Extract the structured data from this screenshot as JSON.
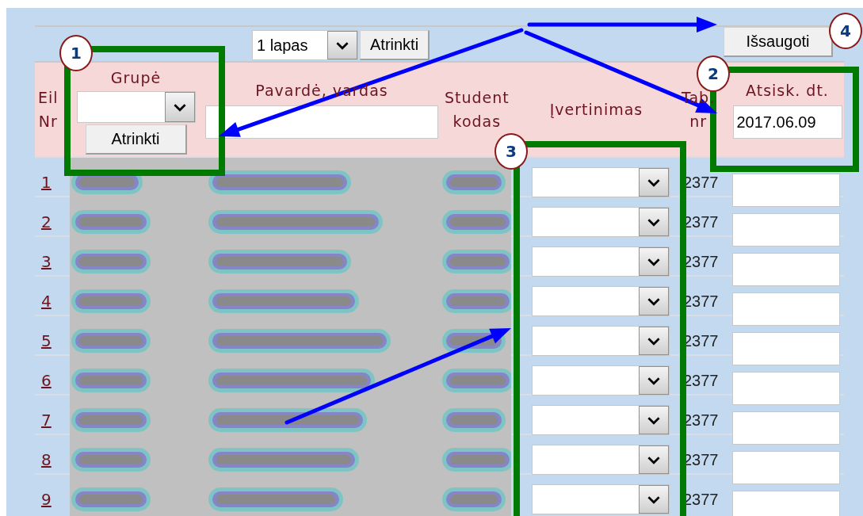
{
  "toolbar": {
    "page_select": {
      "value": "1 lapas"
    },
    "filter_button": "Atrinkti",
    "save_button": "Išsaugoti"
  },
  "header": {
    "row_number": [
      "Eil",
      "Nr"
    ],
    "group": {
      "label": "Grupė",
      "filter_button": "Atrinkti"
    },
    "name": {
      "label": "Pavardė, vardas"
    },
    "student_code": [
      "Student",
      "kodas"
    ],
    "grade": "Įvertinimas",
    "tab_number": [
      "Tab.",
      "nr"
    ],
    "settlement_date": {
      "label": "Atsisk. dt.",
      "value": "2017.06.09"
    }
  },
  "rows": [
    {
      "number": "1",
      "tab_number": "2377"
    },
    {
      "number": "2",
      "tab_number": "2377"
    },
    {
      "number": "3",
      "tab_number": "2377"
    },
    {
      "number": "4",
      "tab_number": "2377"
    },
    {
      "number": "5",
      "tab_number": "2377"
    },
    {
      "number": "6",
      "tab_number": "2377"
    },
    {
      "number": "7",
      "tab_number": "2377"
    },
    {
      "number": "8",
      "tab_number": "2377"
    },
    {
      "number": "9",
      "tab_number": "2377"
    }
  ],
  "annotations": [
    {
      "number": "1"
    },
    {
      "number": "2"
    },
    {
      "number": "3"
    },
    {
      "number": "4"
    }
  ]
}
